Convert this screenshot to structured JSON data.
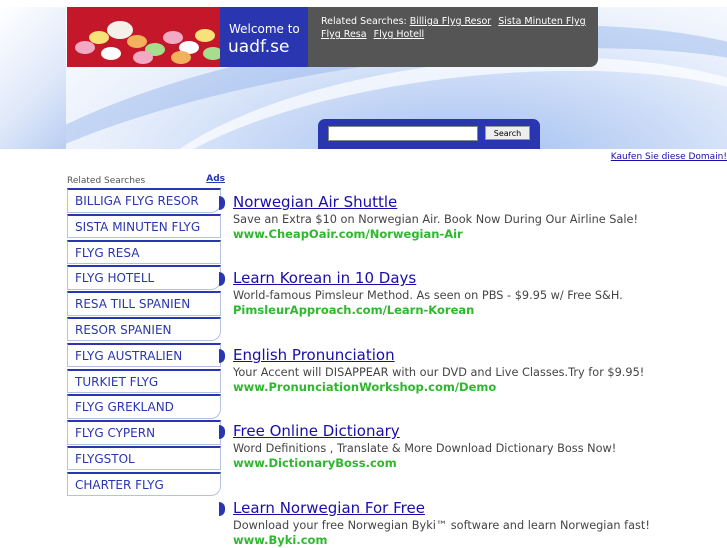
{
  "header": {
    "welcome_line1": "Welcome to",
    "welcome_line2": "uadf.se",
    "related_label": "Related Searches:",
    "related_links": [
      "Billiga Flyg Resor",
      "Sista Minuten Flyg",
      "Flyg Resa",
      "Flyg Hotell"
    ]
  },
  "search": {
    "button_label": "Search",
    "value": ""
  },
  "kaufen_link": "Kaufen Sie diese Domain!",
  "sidebar": {
    "heading": "Related Searches",
    "ads_label": "Ads",
    "items": [
      "BILLIGA FLYG RESOR",
      "SISTA MINUTEN FLYG",
      "FLYG RESA",
      "FLYG HOTELL",
      "RESA TILL SPANIEN",
      "RESOR SPANIEN",
      "FLYG AUSTRALIEN",
      "TURKIET FLYG",
      "FLYG GREKLAND",
      "FLYG CYPERN",
      "FLYGSTOL",
      "CHARTER FLYG"
    ]
  },
  "ads": [
    {
      "title": "Norwegian Air Shuttle",
      "desc": "Save an Extra $10 on Norwegian Air. Book Now During Our Airline Sale!",
      "url": "www.CheapOair.com/Norwegian-Air"
    },
    {
      "title": "Learn Korean in 10 Days",
      "desc": "World-famous Pimsleur Method. As seen on PBS - $9.95 w/ Free S&H.",
      "url": "PimsleurApproach.com/Learn-Korean"
    },
    {
      "title": "English Pronunciation",
      "desc": "Your Accent will DISAPPEAR with our DVD and Live Classes.Try for $9.95!",
      "url": "www.PronunciationWorkshop.com/Demo"
    },
    {
      "title": "Free Online Dictionary",
      "desc": "Word Definitions , Translate & More Download Dictionary Boss Now!",
      "url": "www.DictionaryBoss.com"
    },
    {
      "title": "Learn Norwegian For Free",
      "desc": "Download your free Norwegian Byki™ software and learn Norwegian fast!",
      "url": "www.Byki.com"
    }
  ]
}
